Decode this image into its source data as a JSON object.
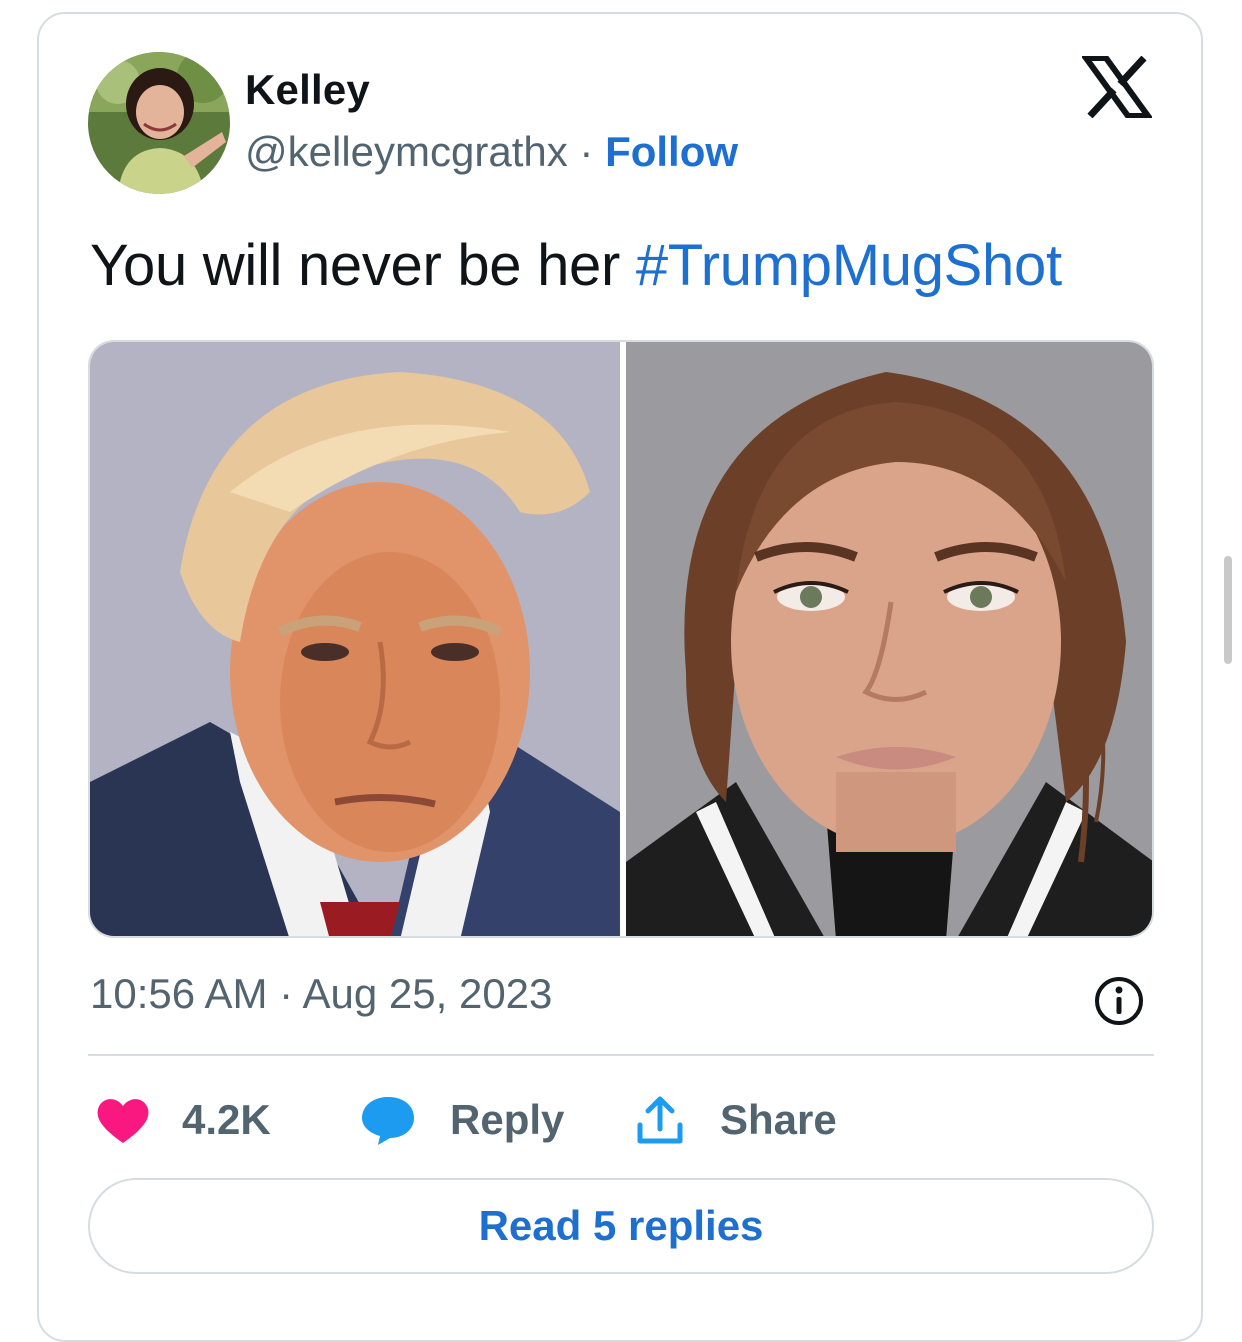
{
  "author": {
    "name": "Kelley",
    "handle": "@kelleymcgrathx",
    "separator": "·",
    "follow_label": "Follow",
    "name_emoji_icon": "crescent-moon-icon",
    "avatar_icon": "profile-photo"
  },
  "platform_icon": "x-logo-icon",
  "tweet": {
    "text": "You will never be her",
    "hashtag": "#TrumpMugShot"
  },
  "media": {
    "images": [
      "mugshot-man-blue-suit-red-tie",
      "mugshot-woman-striped-jacket"
    ]
  },
  "meta": {
    "time": "10:56 AM",
    "separator": "·",
    "date": "Aug 25, 2023",
    "info_icon": "info-icon"
  },
  "actions": {
    "like_count": "4.2K",
    "reply_label": "Reply",
    "share_label": "Share"
  },
  "read_replies_label": "Read 5 replies",
  "colors": {
    "accent": "#1d6fd0",
    "like": "#f91880",
    "muted": "#536471",
    "border": "#d6dce1"
  }
}
